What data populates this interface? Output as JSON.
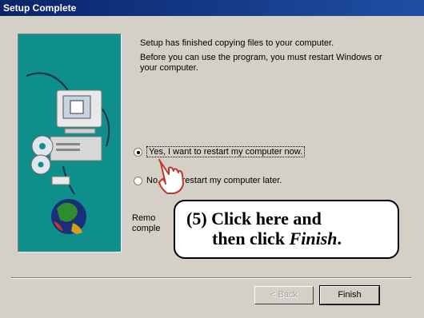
{
  "window": {
    "title": "Setup Complete"
  },
  "message": {
    "line1": "Setup has finished copying files to your computer.",
    "line2a": "Before you can use the program, you must restart Windows or",
    "line2b": "your computer."
  },
  "options": [
    {
      "label": "Yes, I want to restart my computer now.",
      "selected": true
    },
    {
      "label": "No, I will restart my computer later.",
      "selected": false
    }
  ],
  "partial_text": {
    "line1": "Remo",
    "line2": "comple"
  },
  "callout": {
    "line1": "(5) Click here and",
    "line2_prefix": "then click ",
    "line2_emph": "Finish",
    "line2_suffix": "."
  },
  "buttons": {
    "back": "< Back",
    "finish": "Finish"
  }
}
